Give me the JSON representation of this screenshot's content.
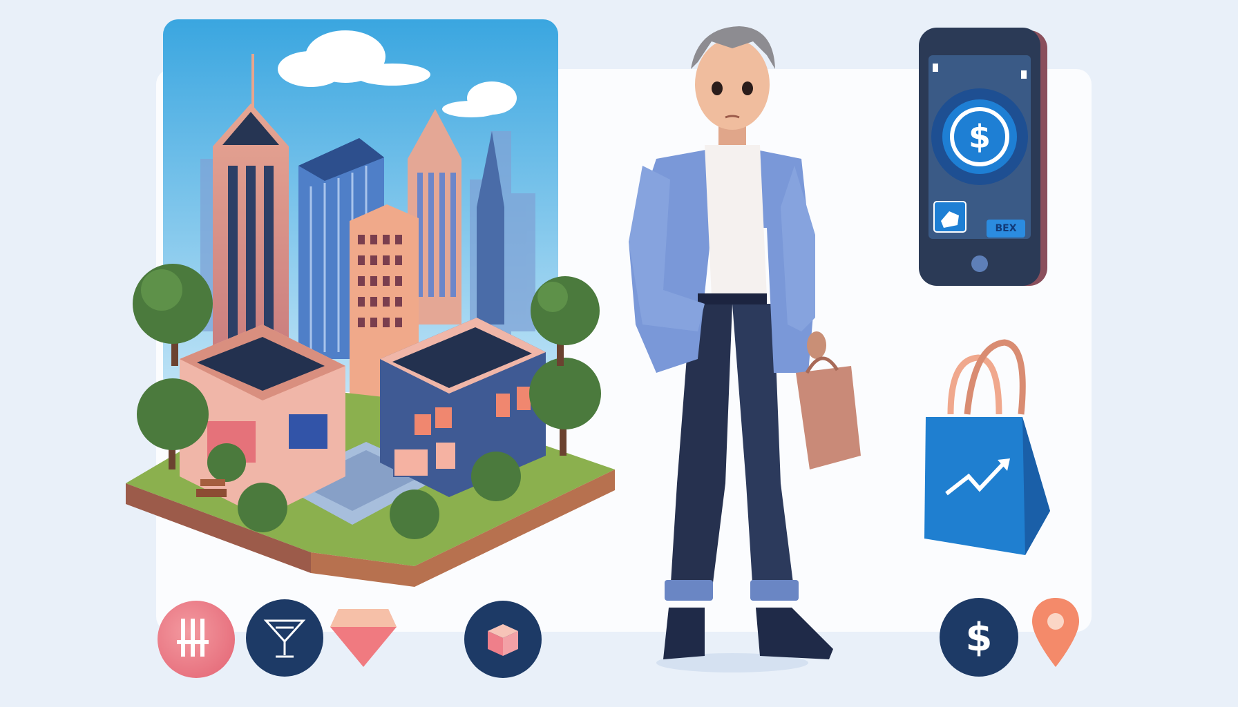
{
  "phone": {
    "button_label": "BEX",
    "coin_symbol": "$"
  },
  "bottom_icons": {
    "dollar_symbol": "$"
  },
  "colors": {
    "background": "#e9f0f9",
    "sky_top": "#3aa6e0",
    "sky_bottom": "#bfe3f6",
    "phone_body": "#2b3a56",
    "phone_screen": "#3a5a86",
    "coin": "#1e7fd4",
    "bag_blue": "#1f7fd0",
    "badge_navy": "#1d3a66",
    "badge_pink": "#ec6c7c",
    "gem_pink": "#f07a80",
    "pin_orange": "#f48a6a"
  },
  "icons": [
    "city-scene-illustration",
    "person-with-shopping-bag",
    "smartphone-payment-icon",
    "shopping-bag-growth-icon",
    "pillars-badge-icon",
    "cocktail-glass-icon",
    "gem-icon",
    "box-icon",
    "dollar-badge-icon",
    "location-pin-icon"
  ]
}
